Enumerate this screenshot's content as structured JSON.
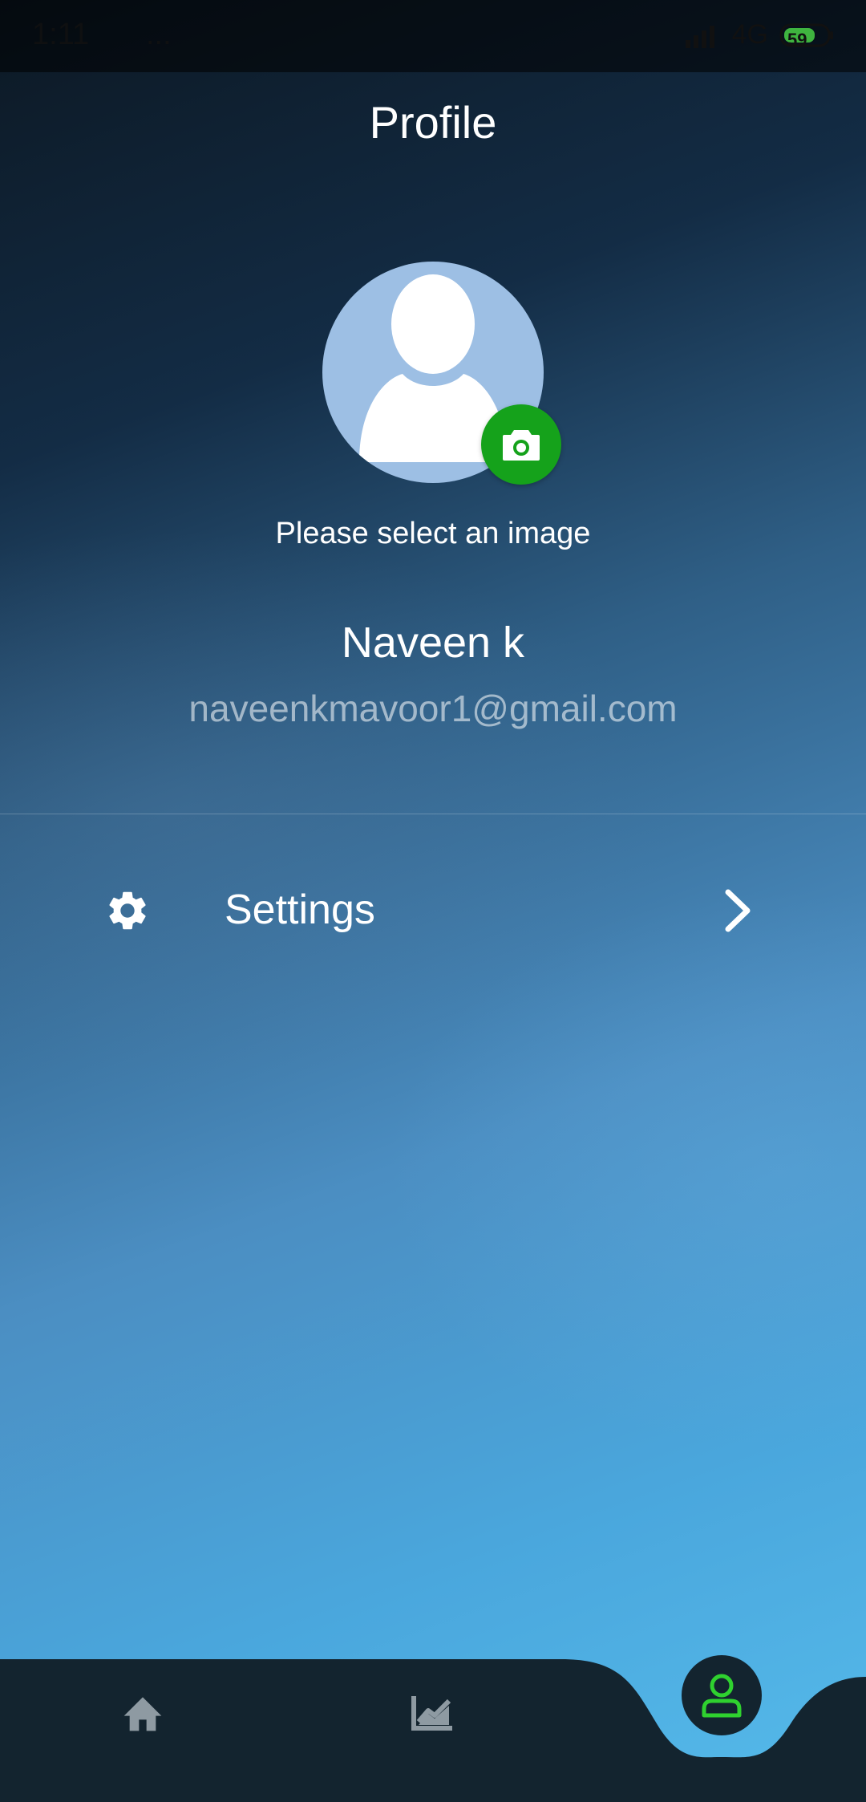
{
  "status_bar": {
    "time": "1:11",
    "extra": "...",
    "network": "4G",
    "battery": "59"
  },
  "header": {
    "title": "Profile"
  },
  "profile": {
    "select_image_text": "Please select an image",
    "name": "Naveen k",
    "email": "naveenkmavoor1@gmail.com"
  },
  "menu": {
    "settings_label": "Settings"
  },
  "colors": {
    "accent_green": "#15a21b",
    "nav_bar": "#13242f",
    "active_nav_icon": "#2fd12f",
    "avatar_bg": "#9dbfe4"
  },
  "icons": {
    "camera": "camera-icon",
    "settings": "gear-icon",
    "chevron": "chevron-right-icon",
    "home": "home-icon",
    "stats": "trending-up-icon",
    "profile": "person-icon"
  },
  "bottom_nav": {
    "active_tab": "profile"
  }
}
